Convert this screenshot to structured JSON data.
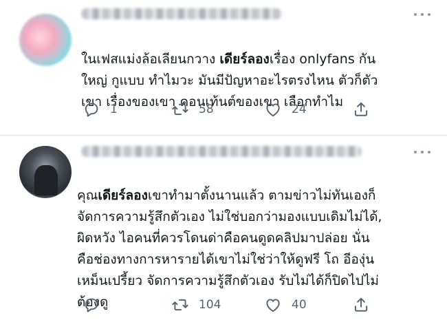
{
  "tweets": [
    {
      "text_parts": [
        {
          "t": "ในเฟสแม่งล้อเลียนกวาง ",
          "b": false
        },
        {
          "t": "เดียร์ลอง",
          "b": true
        },
        {
          "t": "เรื่อง onlyfans กัน\nใหญ่ กูแบบ ทำไมวะ มันมีปัญหาอะไรตรงไหน ตัวก็ตัว\nเขา เรื่องของเขา คอนเท้นต์ของเขา เลือกทำไม",
          "b": false
        }
      ],
      "reply_count": "1",
      "retweet_count": "58",
      "like_count": "24"
    },
    {
      "text_parts": [
        {
          "t": "คุณ",
          "b": false
        },
        {
          "t": "เดียร์ลอง",
          "b": true
        },
        {
          "t": "เขาทำมาตั้งนานแล้ว ตามข่าวไม่ทันเองก็\nจัดการความรู้สึกตัวเอง ไม่ใช่บอกว่ามองแบบเดิมไม่ได้,\nผิดหวัง ไอคนที่ควรโดนด่าคือคนดูดคลิปมาปล่อย นั่น\nคือช่องทางการหารายได้เขาไม่ใช่ว่าให้ดูฟรี โถ อีองุ่น\nเหม็นเปรี้ยว จัดการความรู้สึกตัวเอง รับไม่ได้ก็ปิดไปไม่\nต้องดู",
          "b": false
        }
      ],
      "reply_count": "",
      "retweet_count": "104",
      "like_count": "40"
    }
  ],
  "icons": [
    "reply-icon",
    "retweet-icon",
    "like-icon",
    "share-icon",
    "more-icon"
  ],
  "colors": {
    "icon": "#536471",
    "text": "#14171a",
    "divider": "#dfe3e6"
  }
}
